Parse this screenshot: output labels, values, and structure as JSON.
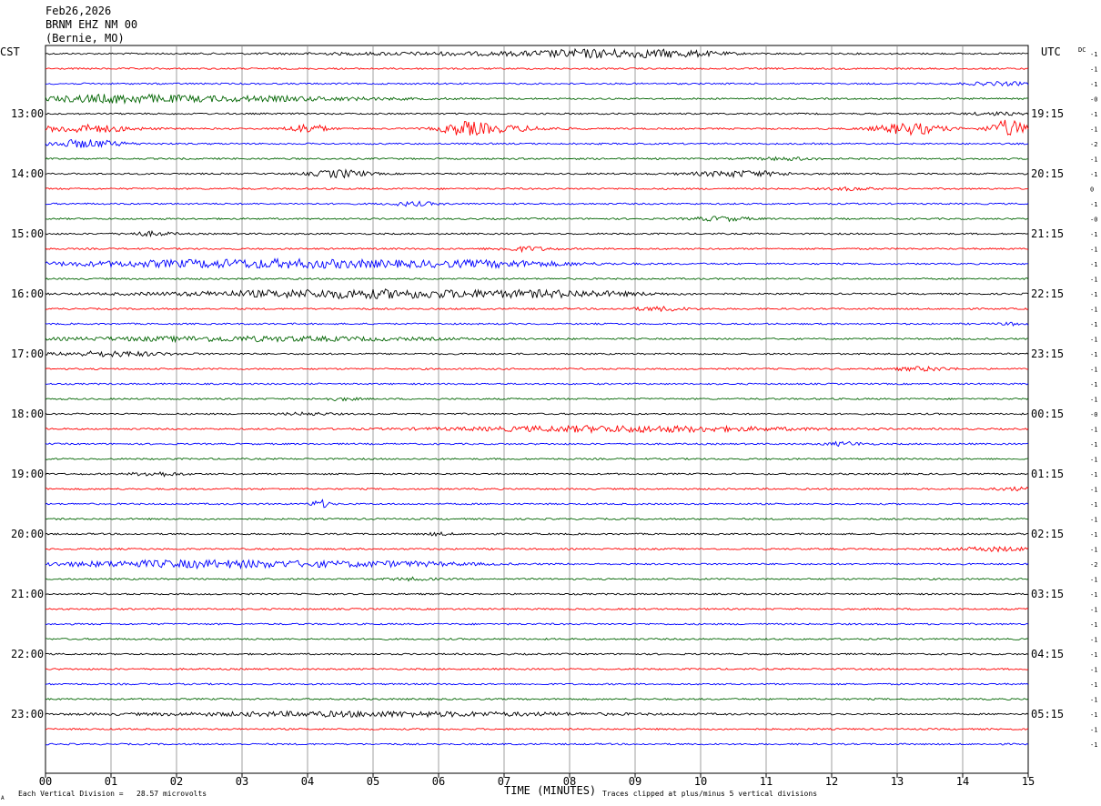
{
  "header": {
    "date": "Feb26,2026",
    "station": "BRNM EHZ NM 00",
    "location": "(Bernie, MO)"
  },
  "left_timezone": "CST",
  "right_timezone": "UTC",
  "dc_label": "DC",
  "footer": {
    "vertical_division": "Each Vertical Division =   28.57 microvolts",
    "x_title": "TIME (MINUTES)",
    "clip_note": "Traces clipped at plus/minus 5 vertical divisions",
    "corner_mark": "A"
  },
  "colors": {
    "trace_cycle": [
      "#000000",
      "#ff0000",
      "#0000ff",
      "#006400"
    ],
    "grid": "#888888",
    "text": "#000000"
  },
  "chart_data": {
    "type": "helicorder",
    "x_ticks": [
      "00",
      "01",
      "02",
      "03",
      "04",
      "05",
      "06",
      "07",
      "08",
      "09",
      "10",
      "11",
      "12",
      "13",
      "14",
      "15"
    ],
    "x_range_minutes": [
      0,
      15
    ],
    "rows_per_hour": 4,
    "left_hour_labels": [
      "13:00",
      "14:00",
      "15:00",
      "16:00",
      "17:00",
      "18:00",
      "19:00",
      "20:00",
      "21:00",
      "22:00",
      "23:00"
    ],
    "right_hour_labels": [
      "19:15",
      "20:15",
      "21:15",
      "22:15",
      "23:15",
      "00:15",
      "01:15",
      "02:15",
      "03:15",
      "04:15",
      "05:15"
    ],
    "dc_offsets": [
      "-1",
      "-1",
      "-1",
      "-0",
      "-1",
      "-1",
      "-2",
      "-1",
      "-1",
      "0",
      "-1",
      "-0",
      "-1",
      "-1",
      "-1",
      "-1",
      "-1",
      "-1",
      "-1",
      "-1",
      "-1",
      "-1",
      "-1",
      "-1",
      "-0",
      "-1",
      "-1",
      "-1",
      "-1",
      "-1",
      "-1",
      "-1",
      "-1",
      "-1",
      "-2",
      "-1",
      "-1",
      "-1",
      "-1",
      "-1",
      "-1",
      "-1",
      "-1",
      "-1",
      "-1",
      "-1",
      "-1"
    ],
    "trace_activity": [
      {
        "row": 0,
        "bursts": [
          [
            8.3,
            1.2,
            3.5
          ],
          [
            9.6,
            1.0,
            3.2
          ],
          [
            6.5,
            3.5,
            1.4
          ]
        ]
      },
      {
        "row": 1,
        "bursts": []
      },
      {
        "row": 2,
        "bursts": [
          [
            14.6,
            0.8,
            1.6
          ]
        ]
      },
      {
        "row": 3,
        "bursts": [
          [
            1.0,
            1.5,
            3.5
          ],
          [
            3.0,
            3.0,
            2.4
          ]
        ]
      },
      {
        "row": 4,
        "bursts": [
          [
            14.5,
            0.6,
            1.4
          ]
        ]
      },
      {
        "row": 5,
        "bursts": [
          [
            0.6,
            1.0,
            4.0
          ],
          [
            4.0,
            0.4,
            5.0
          ],
          [
            6.4,
            0.5,
            6.0
          ],
          [
            7.0,
            1.0,
            3.0
          ],
          [
            13.2,
            0.7,
            6.0
          ],
          [
            14.7,
            0.4,
            9.0
          ]
        ]
      },
      {
        "row": 6,
        "bursts": [
          [
            0.6,
            0.8,
            4.0
          ]
        ]
      },
      {
        "row": 7,
        "bursts": [
          [
            11.3,
            0.7,
            1.4
          ]
        ]
      },
      {
        "row": 8,
        "bursts": [
          [
            4.5,
            0.6,
            4.0
          ],
          [
            10.6,
            1.0,
            3.0
          ]
        ]
      },
      {
        "row": 9,
        "bursts": [
          [
            12.3,
            0.5,
            1.4
          ]
        ]
      },
      {
        "row": 10,
        "bursts": [
          [
            5.6,
            0.5,
            2.0
          ]
        ]
      },
      {
        "row": 11,
        "bursts": [
          [
            10.3,
            0.6,
            2.2
          ]
        ]
      },
      {
        "row": 12,
        "bursts": [
          [
            1.6,
            0.5,
            2.0
          ]
        ]
      },
      {
        "row": 13,
        "bursts": [
          [
            7.3,
            0.6,
            2.2
          ]
        ]
      },
      {
        "row": 14,
        "bursts": [
          [
            3.5,
            4.5,
            4.5
          ],
          [
            7.0,
            1.5,
            2.0
          ]
        ]
      },
      {
        "row": 15,
        "bursts": []
      },
      {
        "row": 16,
        "bursts": [
          [
            5.0,
            4.0,
            4.5
          ],
          [
            8.0,
            1.5,
            2.0
          ]
        ]
      },
      {
        "row": 17,
        "bursts": [
          [
            9.4,
            0.6,
            2.0
          ]
        ]
      },
      {
        "row": 18,
        "bursts": [
          [
            14.8,
            0.4,
            1.2
          ]
        ]
      },
      {
        "row": 19,
        "bursts": [
          [
            3.0,
            4.0,
            2.4
          ]
        ]
      },
      {
        "row": 20,
        "bursts": [
          [
            1.0,
            1.2,
            2.5
          ]
        ]
      },
      {
        "row": 21,
        "bursts": [
          [
            13.4,
            0.6,
            2.0
          ]
        ]
      },
      {
        "row": 22,
        "bursts": []
      },
      {
        "row": 23,
        "bursts": [
          [
            4.5,
            0.4,
            1.4
          ]
        ]
      },
      {
        "row": 24,
        "bursts": [
          [
            4.0,
            0.5,
            1.3
          ]
        ]
      },
      {
        "row": 25,
        "bursts": [
          [
            8.8,
            3.5,
            3.2
          ]
        ]
      },
      {
        "row": 26,
        "bursts": [
          [
            12.2,
            0.4,
            2.0
          ]
        ]
      },
      {
        "row": 27,
        "bursts": []
      },
      {
        "row": 28,
        "bursts": [
          [
            1.7,
            0.5,
            2.2
          ]
        ]
      },
      {
        "row": 29,
        "bursts": [
          [
            14.8,
            0.4,
            1.6
          ]
        ]
      },
      {
        "row": 30,
        "bursts": [
          [
            4.2,
            0.2,
            4.0
          ]
        ]
      },
      {
        "row": 31,
        "bursts": []
      },
      {
        "row": 32,
        "bursts": [
          [
            6.0,
            0.3,
            1.3
          ]
        ]
      },
      {
        "row": 33,
        "bursts": [
          [
            14.5,
            0.8,
            2.0
          ]
        ]
      },
      {
        "row": 34,
        "bursts": [
          [
            2.5,
            3.5,
            3.8
          ],
          [
            5.5,
            1.5,
            1.6
          ]
        ]
      },
      {
        "row": 35,
        "bursts": [
          [
            5.6,
            0.5,
            1.3
          ]
        ]
      },
      {
        "row": 36,
        "bursts": []
      },
      {
        "row": 37,
        "bursts": []
      },
      {
        "row": 38,
        "bursts": []
      },
      {
        "row": 39,
        "bursts": []
      },
      {
        "row": 40,
        "bursts": []
      },
      {
        "row": 41,
        "bursts": []
      },
      {
        "row": 42,
        "bursts": []
      },
      {
        "row": 43,
        "bursts": []
      },
      {
        "row": 44,
        "bursts": [
          [
            5.0,
            4.5,
            2.5
          ]
        ]
      },
      {
        "row": 45,
        "bursts": []
      },
      {
        "row": 46,
        "bursts": []
      }
    ]
  }
}
